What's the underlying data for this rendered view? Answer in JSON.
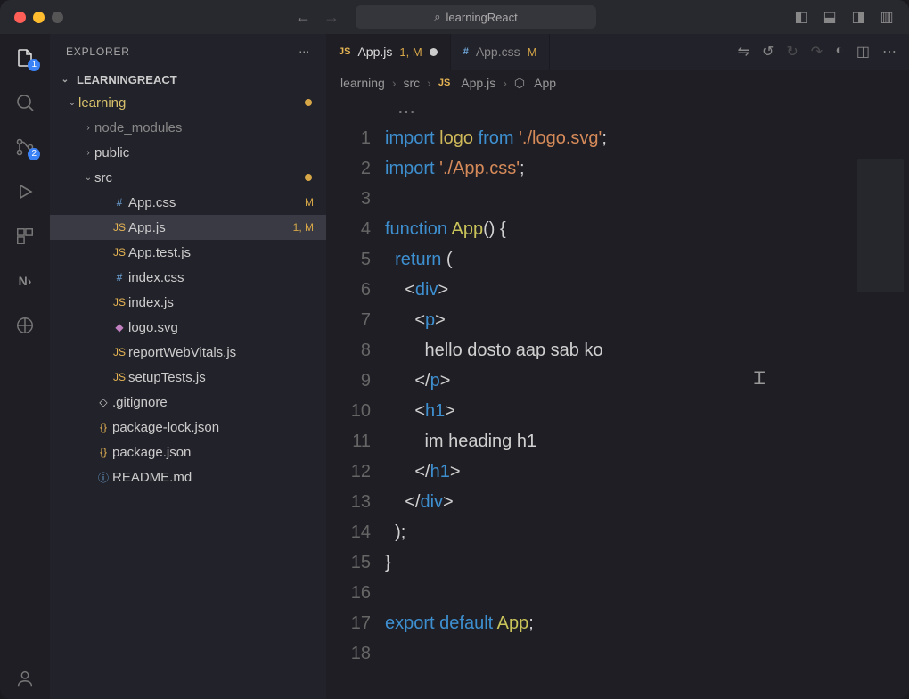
{
  "titlebar": {
    "search_placeholder": "learningReact"
  },
  "sidebar": {
    "title": "EXPLORER",
    "root": "LEARNINGREACT",
    "tree": [
      {
        "depth": 1,
        "chev": "v",
        "name": "learning",
        "cls": "fold-y",
        "mod": true
      },
      {
        "depth": 2,
        "chev": ">",
        "name": "node_modules",
        "cls": "dim"
      },
      {
        "depth": 2,
        "chev": ">",
        "name": "public"
      },
      {
        "depth": 2,
        "chev": "v",
        "name": "src",
        "mod": true
      },
      {
        "depth": 3,
        "icon": "#",
        "iconcls": "css",
        "name": "App.css",
        "status": "M"
      },
      {
        "depth": 3,
        "icon": "JS",
        "iconcls": "js",
        "name": "App.js",
        "status": "1, M",
        "sel": true
      },
      {
        "depth": 3,
        "icon": "JS",
        "iconcls": "js",
        "name": "App.test.js"
      },
      {
        "depth": 3,
        "icon": "#",
        "iconcls": "css",
        "name": "index.css"
      },
      {
        "depth": 3,
        "icon": "JS",
        "iconcls": "js",
        "name": "index.js"
      },
      {
        "depth": 3,
        "icon": "◆",
        "iconcls": "svg",
        "name": "logo.svg"
      },
      {
        "depth": 3,
        "icon": "JS",
        "iconcls": "js",
        "name": "reportWebVitals.js"
      },
      {
        "depth": 3,
        "icon": "JS",
        "iconcls": "js",
        "name": "setupTests.js"
      },
      {
        "depth": 2,
        "icon": "◇",
        "name": ".gitignore"
      },
      {
        "depth": 2,
        "icon": "{}",
        "iconcls": "json",
        "name": "package-lock.json"
      },
      {
        "depth": 2,
        "icon": "{}",
        "iconcls": "json",
        "name": "package.json"
      },
      {
        "depth": 2,
        "icon": "ⓘ",
        "iconcls": "md",
        "name": "README.md"
      }
    ]
  },
  "tabs": [
    {
      "icon": "JS",
      "iconcls": "js",
      "name": "App.js",
      "suffix": "1, M",
      "dirty": true,
      "active": true
    },
    {
      "icon": "#",
      "iconcls": "css",
      "name": "App.css",
      "suffix": "M"
    }
  ],
  "breadcrumbs": [
    "learning",
    "src",
    "App.js",
    "App"
  ],
  "activity_badges": {
    "files": "1",
    "scm": "2"
  },
  "code": {
    "lines": [
      {
        "n": 1,
        "h": "<span class='k-key'>import</span> <span class='k-var'>logo</span> <span class='k-key'>from</span> <span class='k-str'>'./logo.svg'</span>;"
      },
      {
        "n": 2,
        "h": "<span class='k-key'>import</span> <span class='k-str'>'./App.css'</span>;"
      },
      {
        "n": 3,
        "h": ""
      },
      {
        "n": 4,
        "h": "<span class='k-def'>function</span> <span class='k-fn'>App</span>() {"
      },
      {
        "n": 5,
        "h": "  <span class='k-key'>return</span> ("
      },
      {
        "n": 6,
        "h": "    &lt;<span class='k-tag'>div</span>&gt;"
      },
      {
        "n": 7,
        "h": "      &lt;<span class='k-tag'>p</span>&gt;"
      },
      {
        "n": 8,
        "h": "        hello dosto aap sab ko"
      },
      {
        "n": 9,
        "h": "      &lt;/<span class='k-tag'>p</span>&gt;"
      },
      {
        "n": 10,
        "h": "      &lt;<span class='k-tag'>h1</span>&gt;"
      },
      {
        "n": 11,
        "h": "        im heading h1"
      },
      {
        "n": 12,
        "h": "      &lt;/<span class='k-tag'>h1</span>&gt;"
      },
      {
        "n": 13,
        "h": "    &lt;/<span class='k-tag'>div</span>&gt;"
      },
      {
        "n": 14,
        "h": "  );"
      },
      {
        "n": 15,
        "h": "}"
      },
      {
        "n": 16,
        "h": ""
      },
      {
        "n": 17,
        "h": "<span class='k-key'>export</span> <span class='k-key'>default</span> <span class='k-fn'>App</span>;"
      },
      {
        "n": 18,
        "h": ""
      }
    ]
  }
}
